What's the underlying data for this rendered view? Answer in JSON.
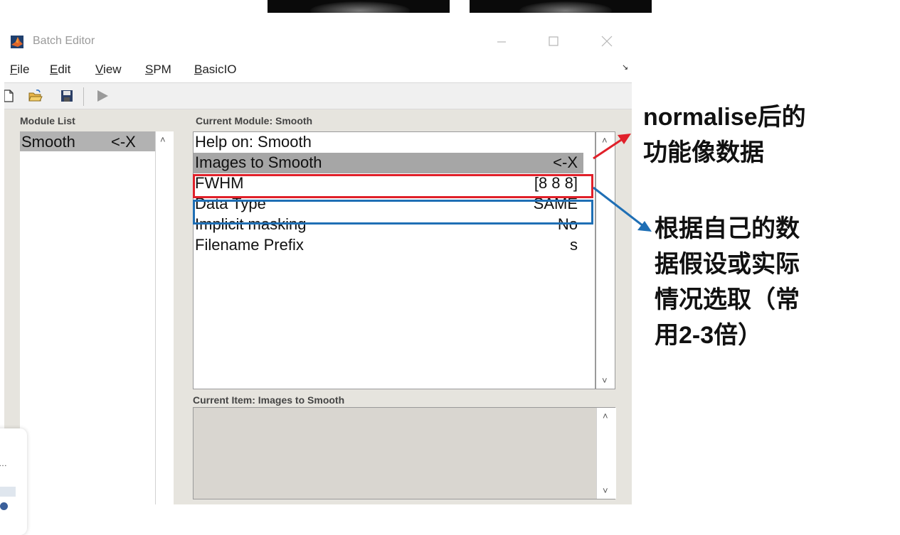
{
  "window": {
    "title": "Batch Editor"
  },
  "menu": [
    "File",
    "Edit",
    "View",
    "SPM",
    "BasicIO"
  ],
  "module_list": {
    "label": "Module List",
    "items": [
      {
        "name": "Smooth",
        "flag": "<-X"
      }
    ]
  },
  "current_module": {
    "label": "Current Module: Smooth",
    "rows": [
      {
        "key": "Help on: Smooth",
        "value": ""
      },
      {
        "key": "Images to Smooth",
        "value": "<-X"
      },
      {
        "key": "FWHM",
        "value": "[8 8 8]"
      },
      {
        "key": "Data Type",
        "value": "SAME"
      },
      {
        "key": "Implicit masking",
        "value": "No"
      },
      {
        "key": "Filename Prefix",
        "value": "s"
      }
    ]
  },
  "current_item": {
    "label": "Current Item: Images to Smooth"
  },
  "annotations": {
    "red_note": [
      "normalise后的",
      "功能像数据"
    ],
    "blue_note": [
      "根据自己的数",
      "据假设或实际",
      "情况选取（常",
      "用2-3倍）"
    ]
  },
  "colors": {
    "red": "#e0202a",
    "blue": "#1f6fb5"
  }
}
